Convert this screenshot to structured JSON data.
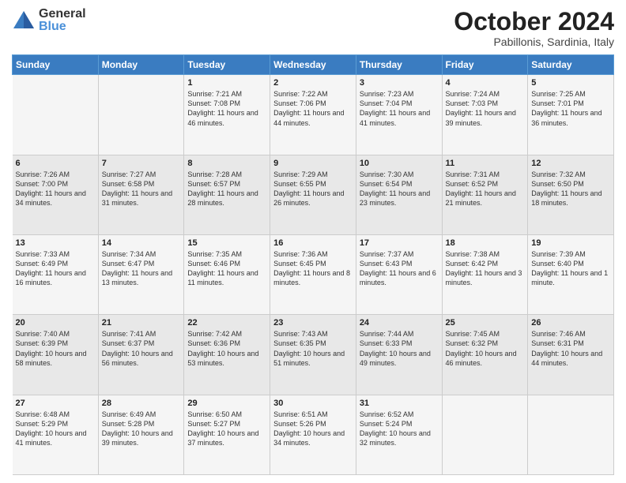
{
  "header": {
    "logo_general": "General",
    "logo_blue": "Blue",
    "month_title": "October 2024",
    "location": "Pabillonis, Sardinia, Italy"
  },
  "weekdays": [
    "Sunday",
    "Monday",
    "Tuesday",
    "Wednesday",
    "Thursday",
    "Friday",
    "Saturday"
  ],
  "weeks": [
    [
      {
        "day": "",
        "sunrise": "",
        "sunset": "",
        "daylight": ""
      },
      {
        "day": "",
        "sunrise": "",
        "sunset": "",
        "daylight": ""
      },
      {
        "day": "1",
        "sunrise": "Sunrise: 7:21 AM",
        "sunset": "Sunset: 7:08 PM",
        "daylight": "Daylight: 11 hours and 46 minutes."
      },
      {
        "day": "2",
        "sunrise": "Sunrise: 7:22 AM",
        "sunset": "Sunset: 7:06 PM",
        "daylight": "Daylight: 11 hours and 44 minutes."
      },
      {
        "day": "3",
        "sunrise": "Sunrise: 7:23 AM",
        "sunset": "Sunset: 7:04 PM",
        "daylight": "Daylight: 11 hours and 41 minutes."
      },
      {
        "day": "4",
        "sunrise": "Sunrise: 7:24 AM",
        "sunset": "Sunset: 7:03 PM",
        "daylight": "Daylight: 11 hours and 39 minutes."
      },
      {
        "day": "5",
        "sunrise": "Sunrise: 7:25 AM",
        "sunset": "Sunset: 7:01 PM",
        "daylight": "Daylight: 11 hours and 36 minutes."
      }
    ],
    [
      {
        "day": "6",
        "sunrise": "Sunrise: 7:26 AM",
        "sunset": "Sunset: 7:00 PM",
        "daylight": "Daylight: 11 hours and 34 minutes."
      },
      {
        "day": "7",
        "sunrise": "Sunrise: 7:27 AM",
        "sunset": "Sunset: 6:58 PM",
        "daylight": "Daylight: 11 hours and 31 minutes."
      },
      {
        "day": "8",
        "sunrise": "Sunrise: 7:28 AM",
        "sunset": "Sunset: 6:57 PM",
        "daylight": "Daylight: 11 hours and 28 minutes."
      },
      {
        "day": "9",
        "sunrise": "Sunrise: 7:29 AM",
        "sunset": "Sunset: 6:55 PM",
        "daylight": "Daylight: 11 hours and 26 minutes."
      },
      {
        "day": "10",
        "sunrise": "Sunrise: 7:30 AM",
        "sunset": "Sunset: 6:54 PM",
        "daylight": "Daylight: 11 hours and 23 minutes."
      },
      {
        "day": "11",
        "sunrise": "Sunrise: 7:31 AM",
        "sunset": "Sunset: 6:52 PM",
        "daylight": "Daylight: 11 hours and 21 minutes."
      },
      {
        "day": "12",
        "sunrise": "Sunrise: 7:32 AM",
        "sunset": "Sunset: 6:50 PM",
        "daylight": "Daylight: 11 hours and 18 minutes."
      }
    ],
    [
      {
        "day": "13",
        "sunrise": "Sunrise: 7:33 AM",
        "sunset": "Sunset: 6:49 PM",
        "daylight": "Daylight: 11 hours and 16 minutes."
      },
      {
        "day": "14",
        "sunrise": "Sunrise: 7:34 AM",
        "sunset": "Sunset: 6:47 PM",
        "daylight": "Daylight: 11 hours and 13 minutes."
      },
      {
        "day": "15",
        "sunrise": "Sunrise: 7:35 AM",
        "sunset": "Sunset: 6:46 PM",
        "daylight": "Daylight: 11 hours and 11 minutes."
      },
      {
        "day": "16",
        "sunrise": "Sunrise: 7:36 AM",
        "sunset": "Sunset: 6:45 PM",
        "daylight": "Daylight: 11 hours and 8 minutes."
      },
      {
        "day": "17",
        "sunrise": "Sunrise: 7:37 AM",
        "sunset": "Sunset: 6:43 PM",
        "daylight": "Daylight: 11 hours and 6 minutes."
      },
      {
        "day": "18",
        "sunrise": "Sunrise: 7:38 AM",
        "sunset": "Sunset: 6:42 PM",
        "daylight": "Daylight: 11 hours and 3 minutes."
      },
      {
        "day": "19",
        "sunrise": "Sunrise: 7:39 AM",
        "sunset": "Sunset: 6:40 PM",
        "daylight": "Daylight: 11 hours and 1 minute."
      }
    ],
    [
      {
        "day": "20",
        "sunrise": "Sunrise: 7:40 AM",
        "sunset": "Sunset: 6:39 PM",
        "daylight": "Daylight: 10 hours and 58 minutes."
      },
      {
        "day": "21",
        "sunrise": "Sunrise: 7:41 AM",
        "sunset": "Sunset: 6:37 PM",
        "daylight": "Daylight: 10 hours and 56 minutes."
      },
      {
        "day": "22",
        "sunrise": "Sunrise: 7:42 AM",
        "sunset": "Sunset: 6:36 PM",
        "daylight": "Daylight: 10 hours and 53 minutes."
      },
      {
        "day": "23",
        "sunrise": "Sunrise: 7:43 AM",
        "sunset": "Sunset: 6:35 PM",
        "daylight": "Daylight: 10 hours and 51 minutes."
      },
      {
        "day": "24",
        "sunrise": "Sunrise: 7:44 AM",
        "sunset": "Sunset: 6:33 PM",
        "daylight": "Daylight: 10 hours and 49 minutes."
      },
      {
        "day": "25",
        "sunrise": "Sunrise: 7:45 AM",
        "sunset": "Sunset: 6:32 PM",
        "daylight": "Daylight: 10 hours and 46 minutes."
      },
      {
        "day": "26",
        "sunrise": "Sunrise: 7:46 AM",
        "sunset": "Sunset: 6:31 PM",
        "daylight": "Daylight: 10 hours and 44 minutes."
      }
    ],
    [
      {
        "day": "27",
        "sunrise": "Sunrise: 6:48 AM",
        "sunset": "Sunset: 5:29 PM",
        "daylight": "Daylight: 10 hours and 41 minutes."
      },
      {
        "day": "28",
        "sunrise": "Sunrise: 6:49 AM",
        "sunset": "Sunset: 5:28 PM",
        "daylight": "Daylight: 10 hours and 39 minutes."
      },
      {
        "day": "29",
        "sunrise": "Sunrise: 6:50 AM",
        "sunset": "Sunset: 5:27 PM",
        "daylight": "Daylight: 10 hours and 37 minutes."
      },
      {
        "day": "30",
        "sunrise": "Sunrise: 6:51 AM",
        "sunset": "Sunset: 5:26 PM",
        "daylight": "Daylight: 10 hours and 34 minutes."
      },
      {
        "day": "31",
        "sunrise": "Sunrise: 6:52 AM",
        "sunset": "Sunset: 5:24 PM",
        "daylight": "Daylight: 10 hours and 32 minutes."
      },
      {
        "day": "",
        "sunrise": "",
        "sunset": "",
        "daylight": ""
      },
      {
        "day": "",
        "sunrise": "",
        "sunset": "",
        "daylight": ""
      }
    ]
  ]
}
